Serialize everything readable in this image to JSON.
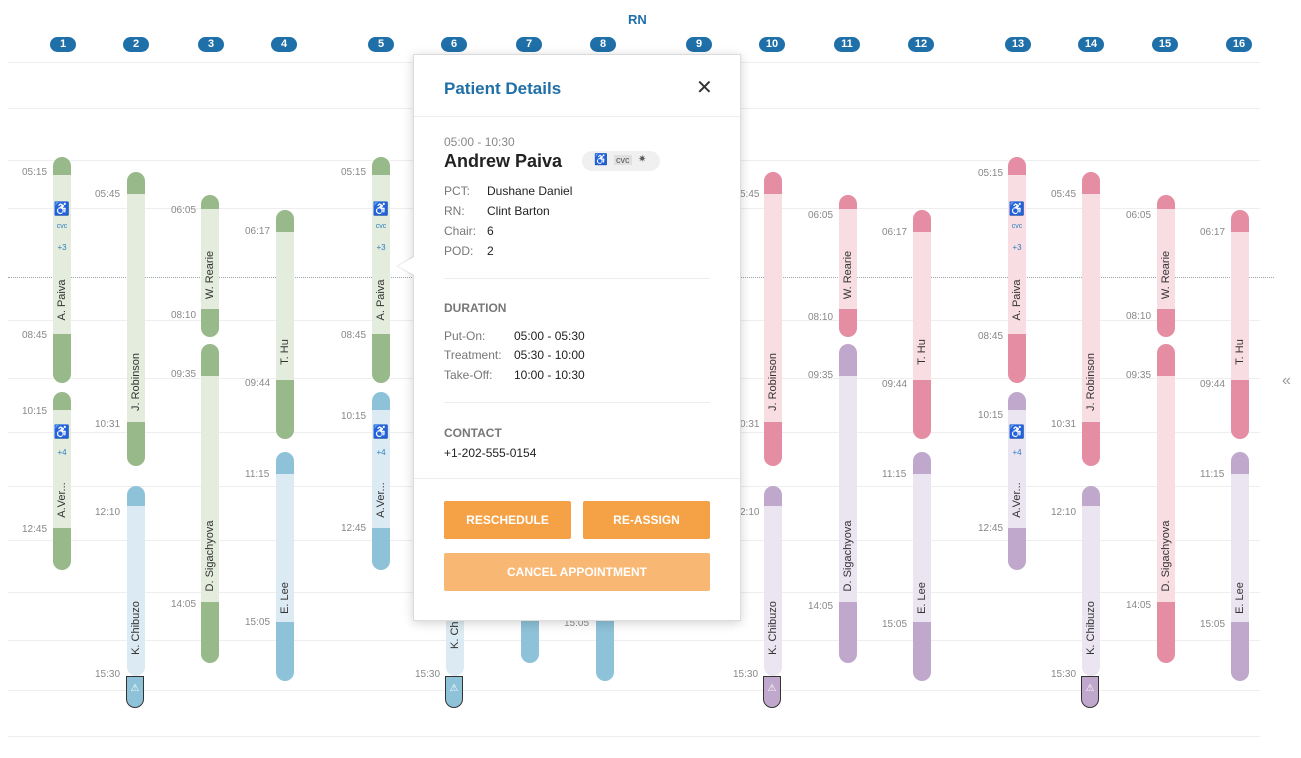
{
  "header": {
    "title": "RN"
  },
  "chairs": [
    "1",
    "2",
    "3",
    "4",
    "5",
    "6",
    "7",
    "8",
    "9",
    "10",
    "11",
    "12",
    "13",
    "14",
    "15",
    "16"
  ],
  "colors": {
    "green_light": "#e3ecdd",
    "green_dark": "#98b98a",
    "blue_light": "#dcebf3",
    "blue_dark": "#8ec2d8",
    "pink_light": "#f8dde3",
    "pink_dark": "#e58da3",
    "purple_light": "#ebe4f1",
    "purple_dark": "#c0a8cc",
    "accent": "#1f6fa8",
    "button": "#f5a145",
    "button_light": "#f8b873"
  },
  "patients": {
    "a_paiva": "A. Paiva",
    "j_robinson": "J. Robinson",
    "w_rearie": "W. Rearie",
    "t_hu": "T. Hu",
    "a_ver": "A.Ver...",
    "d_sigachyova": "D. Sigachyova",
    "e_lee": "E. Lee",
    "k_chibuzo": "K. Chibuzo",
    "k_chi": "K. Chi"
  },
  "badges": {
    "cvc": "cvc",
    "plus3": "+3",
    "plus4": "+4"
  },
  "times": {
    "t0515": "05:15",
    "t0545": "05:45",
    "t0605": "06:05",
    "t0617": "06:17",
    "t0810": "08:10",
    "t0845": "08:45",
    "t0935": "09:35",
    "t0944": "09:44",
    "t1015": "10:15",
    "t1031": "10:31",
    "t1115": "11:15",
    "t1210": "12:10",
    "t1245": "12:45",
    "t1405": "14:05",
    "t1505": "15:05",
    "t1530": "15:30",
    "t545": "5:45",
    "t031": "0:31",
    "t210": "2:10"
  },
  "popup": {
    "title": "Patient Details",
    "time": "05:00 - 10:30",
    "name": "Andrew Paiva",
    "tag_cvc": "cvc",
    "pct_label": "PCT:",
    "pct_value": "Dushane Daniel",
    "rn_label": "RN:",
    "rn_value": "Clint Barton",
    "chair_label": "Chair:",
    "chair_value": "6",
    "pod_label": "POD:",
    "pod_value": "2",
    "duration_heading": "DURATION",
    "puton_label": "Put-On:",
    "puton_value": "05:00 - 05:30",
    "treatment_label": "Treatment:",
    "treatment_value": "05:30 - 10:00",
    "takeoff_label": "Take-Off:",
    "takeoff_value": "10:00 - 10:30",
    "contact_heading": "CONTACT",
    "phone": "+1-202-555-0154",
    "reschedule": "RESCHEDULE",
    "reassign": "RE-ASSIGN",
    "cancel": "CANCEL APPOINTMENT"
  }
}
